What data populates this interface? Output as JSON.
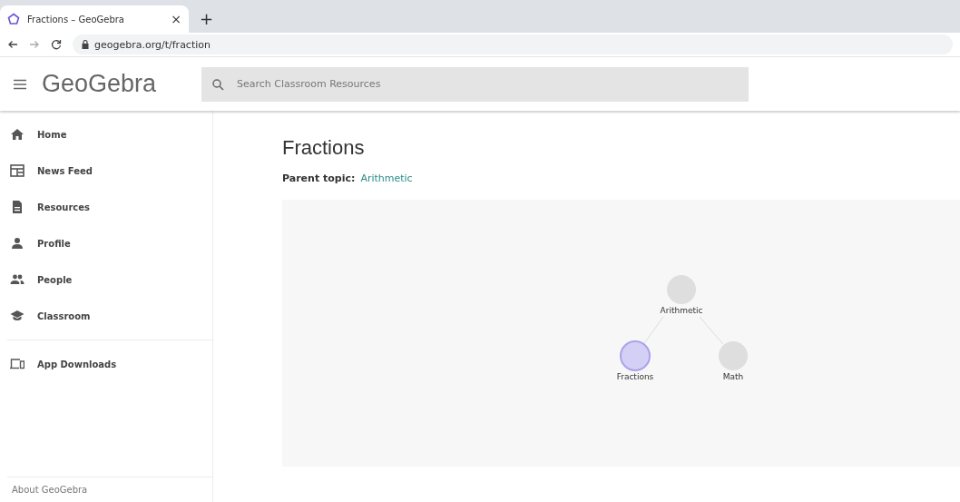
{
  "browser": {
    "tab_title": "Fractions – GeoGebra",
    "tab_close": "×",
    "new_tab": "+",
    "url": "geogebra.org/t/fraction"
  },
  "header": {
    "logo": "GeoGebra",
    "search": {
      "placeholder": "Search Classroom Resources"
    }
  },
  "sidebar": {
    "items": [
      {
        "label": "Home"
      },
      {
        "label": "News Feed"
      },
      {
        "label": "Resources"
      },
      {
        "label": "Profile"
      },
      {
        "label": "People"
      },
      {
        "label": "Classroom"
      }
    ],
    "secondary": [
      {
        "label": "App Downloads"
      }
    ],
    "footer": "About GeoGebra"
  },
  "page": {
    "title": "Fractions",
    "parent_label": "Parent topic:",
    "parent_link": "Arithmetic"
  },
  "graph": {
    "nodes": [
      {
        "label": "Arithmetic",
        "selected": false
      },
      {
        "label": "Fractions",
        "selected": true
      },
      {
        "label": "Math",
        "selected": false
      }
    ]
  }
}
